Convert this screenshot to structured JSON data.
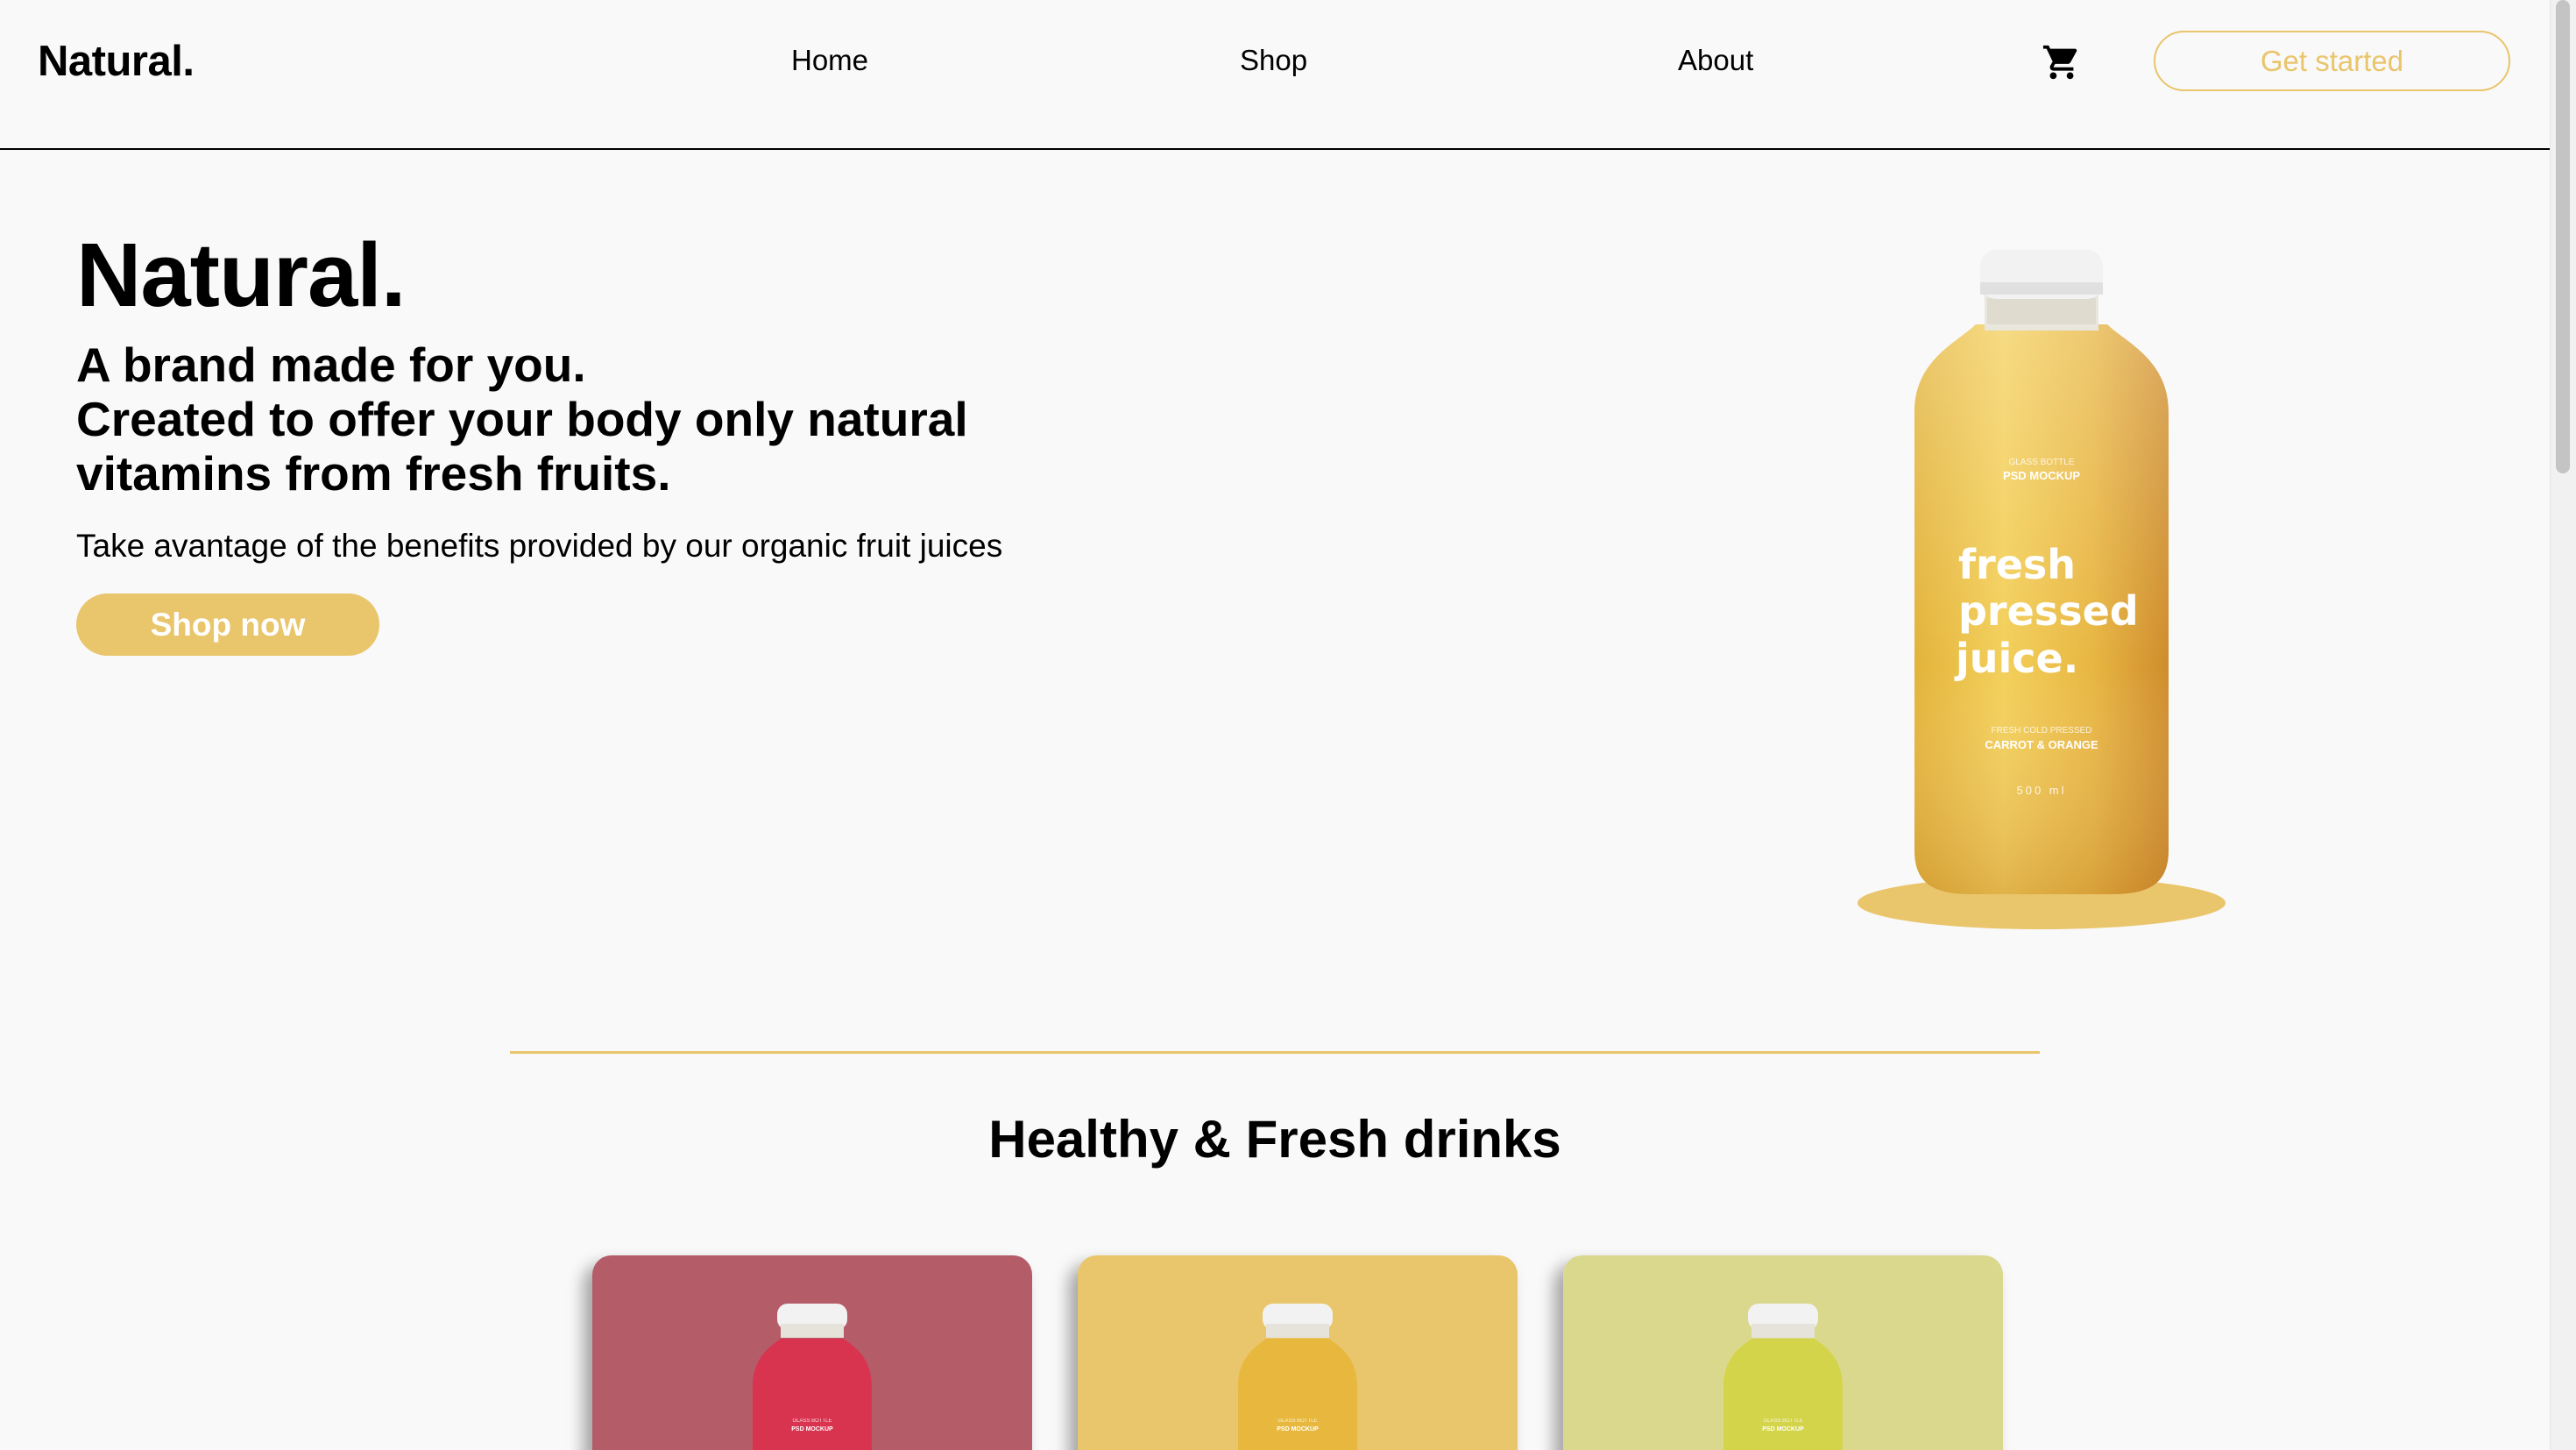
{
  "header": {
    "logo": "Natural.",
    "nav": {
      "home": "Home",
      "shop": "Shop",
      "about": "About"
    },
    "cart_icon": "shopping-cart-icon",
    "cta_label": "Get started"
  },
  "hero": {
    "title": "Natural.",
    "subtitle_lines": [
      "A brand made for you.",
      "Created to offer your body only natural",
      "vitamins from fresh fruits."
    ],
    "description": "Take avantage of the benefits provided by our organic fruit juices",
    "button_label": "Shop now",
    "bottle_label": {
      "small_top": "GLASS BOTTLE",
      "mockup": "PSD MOCKUP",
      "line1": "fresh",
      "line2": "pressed",
      "line3": "juice.",
      "small_mid": "FRESH COLD PRESSED",
      "flavor": "CARROT & ORANGE",
      "volume": "500 ml"
    }
  },
  "products": {
    "title": "Healthy & Fresh drinks",
    "cards": [
      {
        "bg": "#b45c68",
        "juice": "#d8344f",
        "label_top": "GLASS BOTTLE",
        "label": "PSD MOCKUP"
      },
      {
        "bg": "#e9c56b",
        "juice": "#e8b83e",
        "label_top": "GLASS BOTTLE",
        "label": "PSD MOCKUP"
      },
      {
        "bg": "#dad88c",
        "juice": "#d4d44a",
        "label_top": "GLASS BOTTLE",
        "label": "PSD MOCKUP"
      }
    ]
  },
  "colors": {
    "accent": "#e9c56b",
    "background": "#f9f9f9",
    "text": "#000000"
  }
}
